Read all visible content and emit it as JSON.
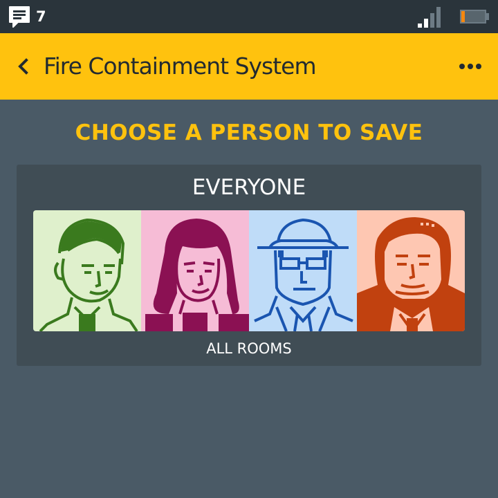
{
  "status_bar": {
    "notification_count": "7",
    "notification_icon": "message-icon",
    "signal_icon": "signal-icon",
    "battery_icon": "battery-low-icon",
    "battery_level": 0.15
  },
  "app_bar": {
    "title": "Fire Containment System",
    "back_icon": "chevron-left-icon",
    "more_icon": "more-horizontal-icon"
  },
  "main": {
    "heading": "CHOOSE A PERSON TO SAVE",
    "option": {
      "title": "EVERYONE",
      "subtitle": "ALL ROOMS",
      "portraits": [
        {
          "name": "portrait-1",
          "bg": "#dff0cc",
          "ink": "#3a7a1e"
        },
        {
          "name": "portrait-2",
          "bg": "#f6bcd6",
          "ink": "#8b1153"
        },
        {
          "name": "portrait-3",
          "bg": "#bfdcf8",
          "ink": "#1a55b0"
        },
        {
          "name": "portrait-4",
          "bg": "#fec7b2",
          "ink": "#c1410f"
        }
      ]
    }
  },
  "colors": {
    "accent": "#ffc20e",
    "background": "#4a5a66",
    "status_bar": "#2a343b",
    "card": "#404d55"
  }
}
